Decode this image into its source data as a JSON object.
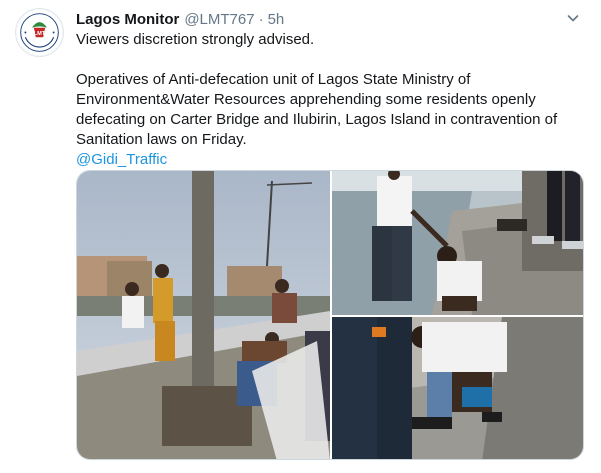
{
  "tweet": {
    "author_name": "Lagos Monitor",
    "handle": "@LMT767",
    "separator": "·",
    "time": "5h",
    "text_line1": "Viewers discretion strongly advised.",
    "text_line2": "Operatives of Anti-defecation unit of Lagos State Ministry of Environment&Water Resources apprehending some residents openly defecating on Carter Bridge and Ilubirin, Lagos Island in contravention of Sanitation laws on Friday.",
    "mention": "@Gidi_Traffic"
  },
  "avatar": {
    "logo_text": "LMT",
    "ring_text": "Lagos Monitoring Team"
  },
  "icons": {
    "more": "chevron-down-icon"
  },
  "colors": {
    "link": "#1b95e0",
    "muted": "#657786",
    "text": "#14171a",
    "border": "#ccd6dd"
  },
  "media": {
    "count": 3
  }
}
